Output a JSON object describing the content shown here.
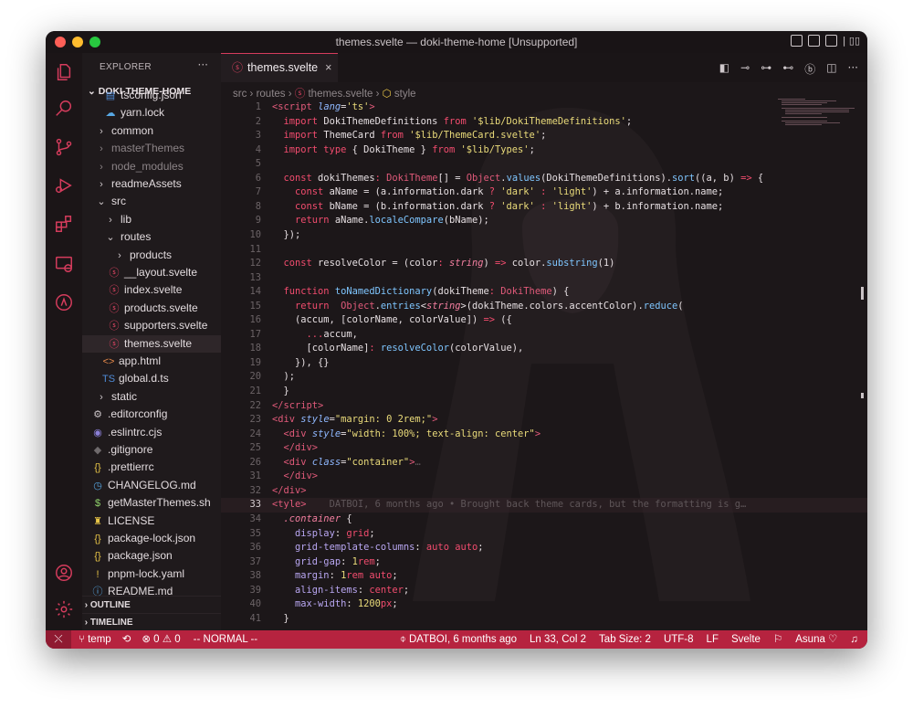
{
  "window": {
    "title": "themes.svelte — doki-theme-home [Unsupported]"
  },
  "explorer": {
    "header": "EXPLORER",
    "more": "···",
    "root": "DOKI-THEME-HOME",
    "items": [
      {
        "label": "tsconfig.json",
        "icon": "ts",
        "color": "#4f8bd6",
        "dim": false
      },
      {
        "label": "yarn.lock",
        "icon": "yarn",
        "color": "#57a7e3",
        "dim": false
      },
      {
        "label": "common",
        "icon": "›",
        "color": "#cfc8cb",
        "dim": false
      },
      {
        "label": "masterThemes",
        "icon": "›",
        "color": "#8c8487",
        "dim": true
      },
      {
        "label": "node_modules",
        "icon": "›",
        "color": "#8c8487",
        "dim": true
      },
      {
        "label": "readmeAssets",
        "icon": "›",
        "color": "#cfc8cb",
        "dim": false
      },
      {
        "label": "src",
        "icon": "⌄",
        "color": "#cfc8cb",
        "dim": false
      },
      {
        "label": "lib",
        "icon": "›",
        "color": "#cfc8cb",
        "dim": false
      },
      {
        "label": "routes",
        "icon": "⌄",
        "color": "#cfc8cb",
        "dim": false
      },
      {
        "label": "products",
        "icon": "›",
        "color": "#cfc8cb",
        "dim": false
      },
      {
        "label": "__layout.svelte",
        "icon": "svelte",
        "color": "#e04463",
        "dim": false
      },
      {
        "label": "index.svelte",
        "icon": "svelte",
        "color": "#e04463",
        "dim": false
      },
      {
        "label": "products.svelte",
        "icon": "svelte",
        "color": "#e04463",
        "dim": false
      },
      {
        "label": "supporters.svelte",
        "icon": "svelte",
        "color": "#e04463",
        "dim": false
      },
      {
        "label": "themes.svelte",
        "icon": "svelte",
        "color": "#e04463",
        "dim": false
      },
      {
        "label": "app.html",
        "icon": "<>",
        "color": "#e88a4a",
        "dim": false
      },
      {
        "label": "global.d.ts",
        "icon": "TS",
        "color": "#4f8bd6",
        "dim": false
      },
      {
        "label": "static",
        "icon": "›",
        "color": "#cfc8cb",
        "dim": false
      },
      {
        "label": ".editorconfig",
        "icon": "gear",
        "color": "#c9c2c5",
        "dim": false
      },
      {
        "label": ".eslintrc.cjs",
        "icon": "eslint",
        "color": "#8b7fd6",
        "dim": false
      },
      {
        "label": ".gitignore",
        "icon": "git",
        "color": "#6f6a6c",
        "dim": false
      },
      {
        "label": ".prettierrc",
        "icon": "{}",
        "color": "#e8c547",
        "dim": false
      },
      {
        "label": "CHANGELOG.md",
        "icon": "clock",
        "color": "#57a7e3",
        "dim": false
      },
      {
        "label": "getMasterThemes.sh",
        "icon": "$",
        "color": "#8fd26b",
        "dim": false
      },
      {
        "label": "LICENSE",
        "icon": "license",
        "color": "#e8c547",
        "dim": false
      },
      {
        "label": "package-lock.json",
        "icon": "{}",
        "color": "#e8c547",
        "dim": false
      },
      {
        "label": "package.json",
        "icon": "{}",
        "color": "#e8c547",
        "dim": false
      },
      {
        "label": "pnpm-lock.yaml",
        "icon": "!",
        "color": "#e8c547",
        "dim": false
      },
      {
        "label": "README.md",
        "icon": "info",
        "color": "#57a7e3",
        "dim": false
      }
    ],
    "outline": "OUTLINE",
    "timeline": "TIMELINE"
  },
  "editor": {
    "tab_label": "themes.svelte",
    "tab_close": "×",
    "breadcrumb": [
      "src",
      "routes",
      "themes.svelte",
      "style"
    ],
    "tab_actions": [
      "◧",
      "⊸",
      "⊶",
      "⊷",
      "ⓑ",
      "◫",
      "···"
    ],
    "blame_inline": "DATBOI, 6 months ago • Brought back theme cards, but the formatting is g…"
  },
  "code_lines": [
    {
      "n": "1"
    },
    {
      "n": "2"
    },
    {
      "n": "3"
    },
    {
      "n": "4"
    },
    {
      "n": "5"
    },
    {
      "n": "6"
    },
    {
      "n": "7"
    },
    {
      "n": "8"
    },
    {
      "n": "9"
    },
    {
      "n": "10"
    },
    {
      "n": "11"
    },
    {
      "n": "12"
    },
    {
      "n": "13"
    },
    {
      "n": "14"
    },
    {
      "n": "15"
    },
    {
      "n": "16"
    },
    {
      "n": "17"
    },
    {
      "n": "18"
    },
    {
      "n": "19"
    },
    {
      "n": "20"
    },
    {
      "n": "21"
    },
    {
      "n": "22"
    },
    {
      "n": "23"
    },
    {
      "n": "24"
    },
    {
      "n": "25"
    },
    {
      "n": "26"
    },
    {
      "n": "31"
    },
    {
      "n": "32"
    },
    {
      "n": "33"
    },
    {
      "n": "34"
    },
    {
      "n": "35"
    },
    {
      "n": "36"
    },
    {
      "n": "37"
    },
    {
      "n": "38"
    },
    {
      "n": "39"
    },
    {
      "n": "40"
    },
    {
      "n": "41"
    }
  ],
  "status": {
    "branch": "temp",
    "sync": "⟲",
    "problems": "⊗ 0 ⚠ 0",
    "mode": "-- NORMAL --",
    "blame": "DATBOI, 6 months ago",
    "position": "Ln 33, Col 2",
    "tab_size": "Tab Size: 2",
    "encoding": "UTF-8",
    "eol": "LF",
    "language": "Svelte",
    "theme": "Asuna ♡",
    "bell": "🔔"
  },
  "colors": {
    "accent": "#d63c5d",
    "statusbar": "#b6233f",
    "background": "#1c1719"
  }
}
